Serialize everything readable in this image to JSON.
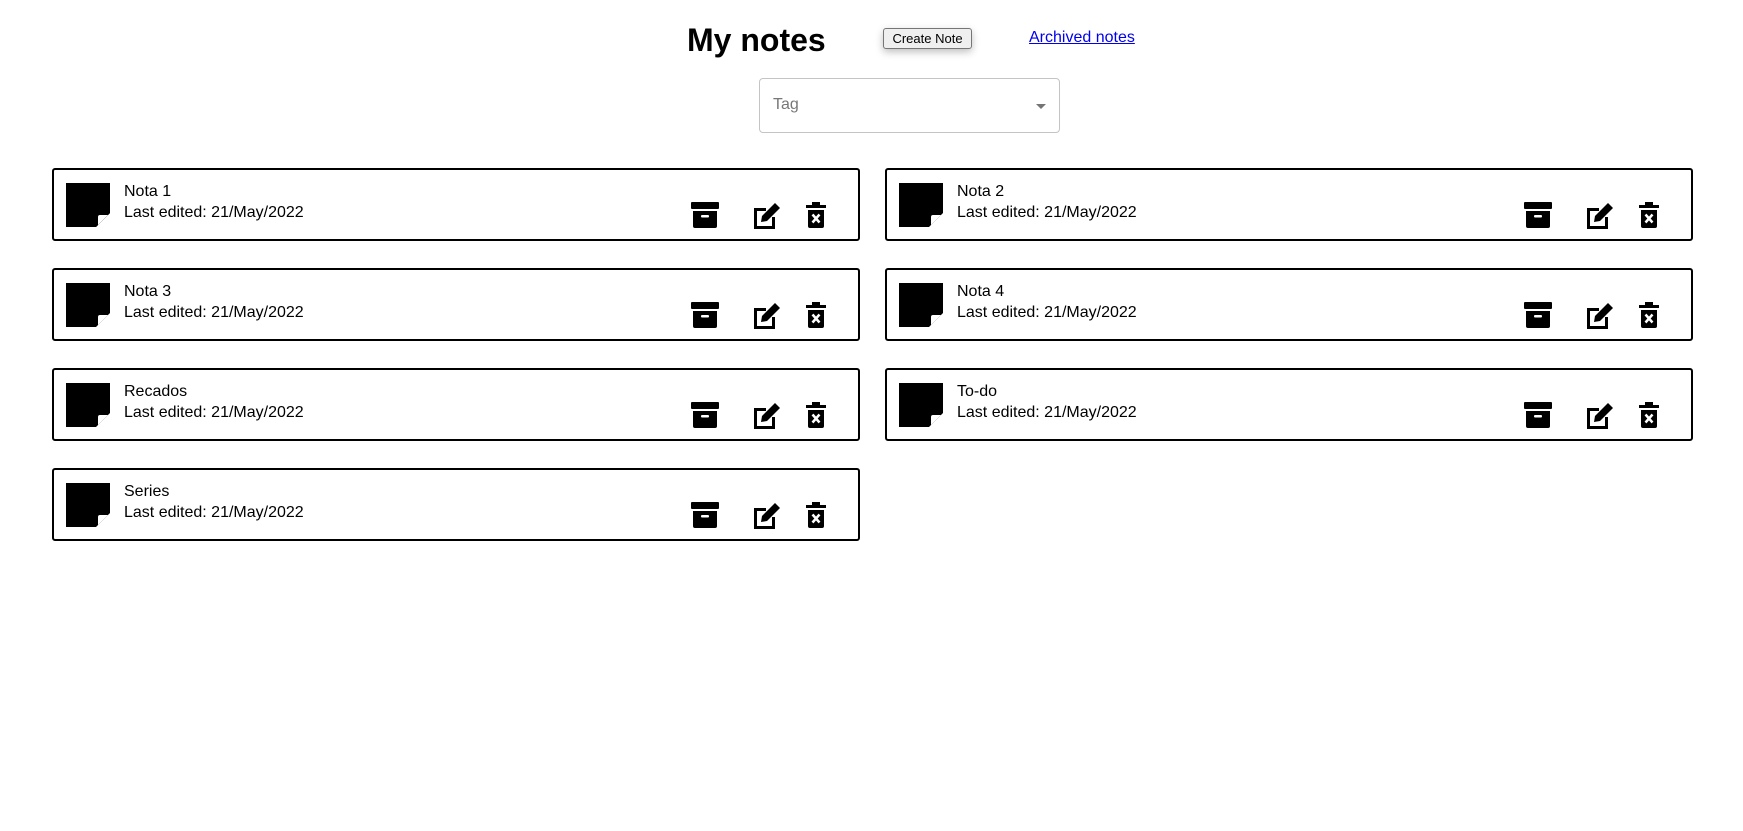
{
  "header": {
    "title": "My notes",
    "create_label": "Create Note",
    "archived_label": "Archived notes"
  },
  "filter": {
    "tag_placeholder": "Tag"
  },
  "notes": [
    {
      "title": "Nota 1",
      "edited": "Last edited: 21/May/2022"
    },
    {
      "title": "Nota 2",
      "edited": "Last edited: 21/May/2022"
    },
    {
      "title": "Nota 3",
      "edited": "Last edited: 21/May/2022"
    },
    {
      "title": "Nota 4",
      "edited": "Last edited: 21/May/2022"
    },
    {
      "title": "Recados",
      "edited": "Last edited: 21/May/2022"
    },
    {
      "title": "To-do",
      "edited": "Last edited: 21/May/2022"
    },
    {
      "title": "Series",
      "edited": "Last edited: 21/May/2022"
    }
  ],
  "icons": {
    "note": "sticky-note-icon",
    "archive": "archive-icon",
    "edit": "edit-icon",
    "delete": "trash-icon"
  }
}
